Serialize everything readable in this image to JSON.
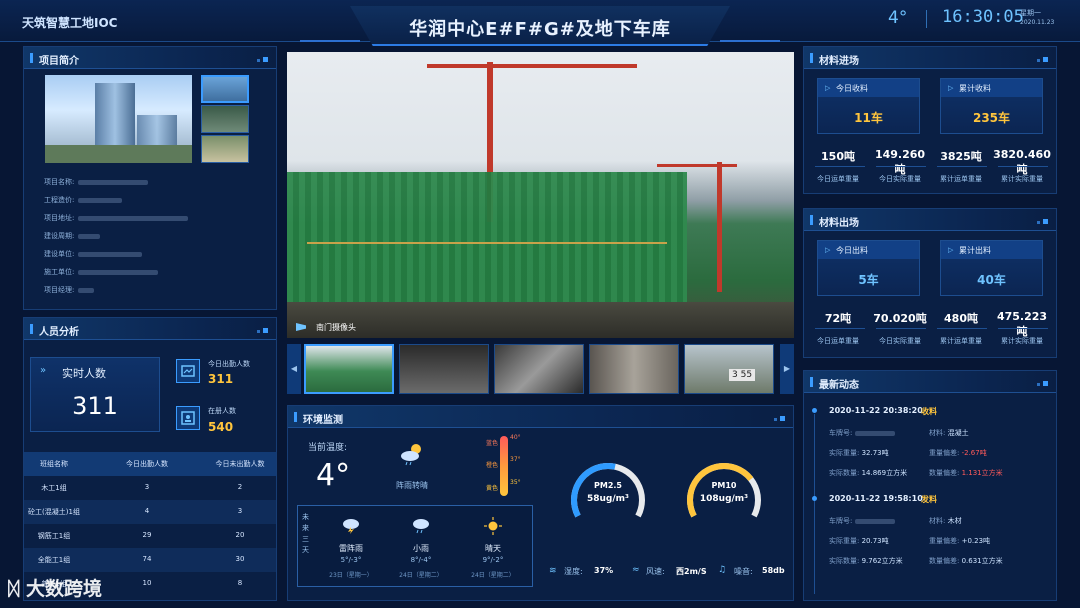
{
  "header": {
    "app_title": "天筑智慧工地IOC",
    "main_title": "华润中心E#F#G#及地下车库",
    "temperature": "4°",
    "time": "16:30:05",
    "weekday": "星期一",
    "date": "2020.11.23"
  },
  "project": {
    "title": "项目简介",
    "fields": [
      {
        "label": "项目名称:"
      },
      {
        "label": "工程造价:"
      },
      {
        "label": "项目地址:"
      },
      {
        "label": "建设周期:"
      },
      {
        "label": "建设单位:"
      },
      {
        "label": "施工单位:"
      },
      {
        "label": "项目经理:"
      }
    ]
  },
  "personnel": {
    "title": "人员分析",
    "realtime_label": "实时人数",
    "realtime_value": "311",
    "today_out_label": "今日出勤人数",
    "today_out_value": "311",
    "onsite_label": "在册人数",
    "onsite_value": "540",
    "table": {
      "headers": [
        "班组名称",
        "今日出勤人数",
        "今日未出勤人数"
      ],
      "rows": [
        [
          "木工1组",
          "3",
          "2"
        ],
        [
          "砼工(混凝土)1组",
          "4",
          "3"
        ],
        [
          "钢筋工1组",
          "29",
          "20"
        ],
        [
          "全能工1组",
          "74",
          "30"
        ],
        [
          "普工1组",
          "10",
          "8"
        ]
      ]
    }
  },
  "video": {
    "camera_label": "南门摄像头",
    "thumb_text": "3 55"
  },
  "environment": {
    "title": "环境监测",
    "current_temp_label": "当前温度:",
    "current_temp": "4°",
    "current_weather": "阵雨转晴",
    "thermo_levels": [
      "蓝色",
      "橙色",
      "黄色"
    ],
    "thermo_ticks": [
      "40°",
      "37°",
      "35°"
    ],
    "forecast_side_label": "未来三天",
    "forecast": [
      {
        "cond": "雷阵雨",
        "temp": "5°/-3°",
        "date": "23日（星期一）",
        "icon": "thunder-icon"
      },
      {
        "cond": "小雨",
        "temp": "8°/-4°",
        "date": "24日（星期二）",
        "icon": "rain-icon"
      },
      {
        "cond": "晴天",
        "temp": "9°/-2°",
        "date": "24日（星期二）",
        "icon": "sun-icon"
      }
    ],
    "pm25": {
      "name": "PM2.5",
      "value": "58ug/m³",
      "level": 0.55
    },
    "pm10": {
      "name": "PM10",
      "value": "108ug/m³",
      "level": 0.72
    },
    "humidity_label": "湿度:",
    "humidity": "37%",
    "wind_label": "风速:",
    "wind": "西2m/S",
    "noise_label": "噪音:",
    "noise": "58db"
  },
  "material_in": {
    "title": "材料进场",
    "today_label": "今日收料",
    "today_value": "11车",
    "total_label": "累计收料",
    "total_value": "235车",
    "stats": [
      {
        "value": "150吨",
        "label": "今日运单重量"
      },
      {
        "value": "149.260吨",
        "label": "今日实际重量"
      },
      {
        "value": "3825吨",
        "label": "累计运单重量"
      },
      {
        "value": "3820.460吨",
        "label": "累计实际重量"
      }
    ]
  },
  "material_out": {
    "title": "材料出场",
    "today_label": "今日出料",
    "today_value": "5车",
    "total_label": "累计出料",
    "total_value": "40车",
    "stats": [
      {
        "value": "72吨",
        "label": "今日运单重量"
      },
      {
        "value": "70.020吨",
        "label": "今日实际重量"
      },
      {
        "value": "480吨",
        "label": "累计运单重量"
      },
      {
        "value": "475.223吨",
        "label": "累计实际重量"
      }
    ]
  },
  "news": {
    "title": "最新动态",
    "items": [
      {
        "time": "2020-11-22 20:38:20",
        "type": "收料",
        "plate_k": "车牌号:",
        "material_k": "材料:",
        "material_v": "混凝土",
        "actual_k": "实际重量:",
        "actual_v": "32.73吨",
        "dev_k": "重量偏差:",
        "dev_v": "-2.67吨",
        "qty_k": "实际数量:",
        "qty_v": "14.869立方米",
        "qdev_k": "数量偏差:",
        "qdev_v": "1.131立方米"
      },
      {
        "time": "2020-11-22 19:58:10",
        "type": "发料",
        "plate_k": "车牌号:",
        "material_k": "材料:",
        "material_v": "木材",
        "actual_k": "实际重量:",
        "actual_v": "20.73吨",
        "dev_k": "重量偏差:",
        "dev_v": "+0.23吨",
        "qty_k": "实际数量:",
        "qty_v": "9.762立方米",
        "qdev_k": "数量偏差:",
        "qdev_v": "0.631立方米"
      }
    ]
  },
  "watermark": "大数跨境",
  "colors": {
    "accent": "#3b9cff",
    "highlight": "#ffc53d",
    "alert": "#ff5a5a",
    "background": "#071634"
  }
}
